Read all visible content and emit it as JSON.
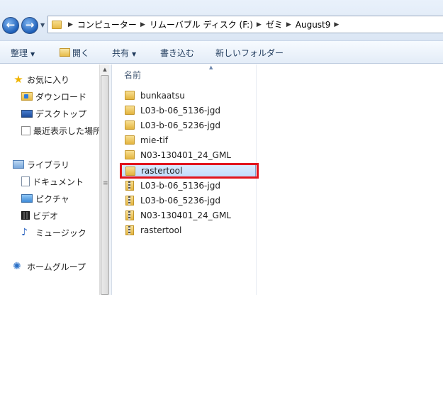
{
  "address_bar": {
    "breadcrumb": [
      "コンピューター",
      "リムーバブル ディスク (F:)",
      "ゼミ",
      "August9"
    ],
    "back_icon": "back-arrow-icon",
    "forward_icon": "forward-arrow-icon"
  },
  "toolbar": {
    "organize": "整理",
    "open": "開く",
    "share": "共有",
    "burn": "書き込む",
    "new_folder": "新しいフォルダー"
  },
  "sidebar": {
    "favorites": "お気に入り",
    "downloads": "ダウンロード",
    "desktop": "デスクトップ",
    "recent": "最近表示した場所",
    "libraries": "ライブラリ",
    "documents": "ドキュメント",
    "pictures": "ピクチャ",
    "videos": "ビデオ",
    "music": "ミュージック",
    "homegroup": "ホームグループ"
  },
  "file_list": {
    "column_name": "名前",
    "items": [
      {
        "name": "bunkaatsu",
        "type": "folder"
      },
      {
        "name": "L03-b-06_5136-jgd",
        "type": "folder"
      },
      {
        "name": "L03-b-06_5236-jgd",
        "type": "folder"
      },
      {
        "name": "mie-tif",
        "type": "folder"
      },
      {
        "name": "N03-130401_24_GML",
        "type": "folder"
      },
      {
        "name": "rastertool",
        "type": "folder",
        "selected": true
      },
      {
        "name": "L03-b-06_5136-jgd",
        "type": "zip"
      },
      {
        "name": "L03-b-06_5236-jgd",
        "type": "zip"
      },
      {
        "name": "N03-130401_24_GML",
        "type": "zip"
      },
      {
        "name": "rastertool",
        "type": "zip"
      }
    ]
  },
  "colors": {
    "highlight": "#e2141c",
    "selection": "#c1dcfc"
  }
}
